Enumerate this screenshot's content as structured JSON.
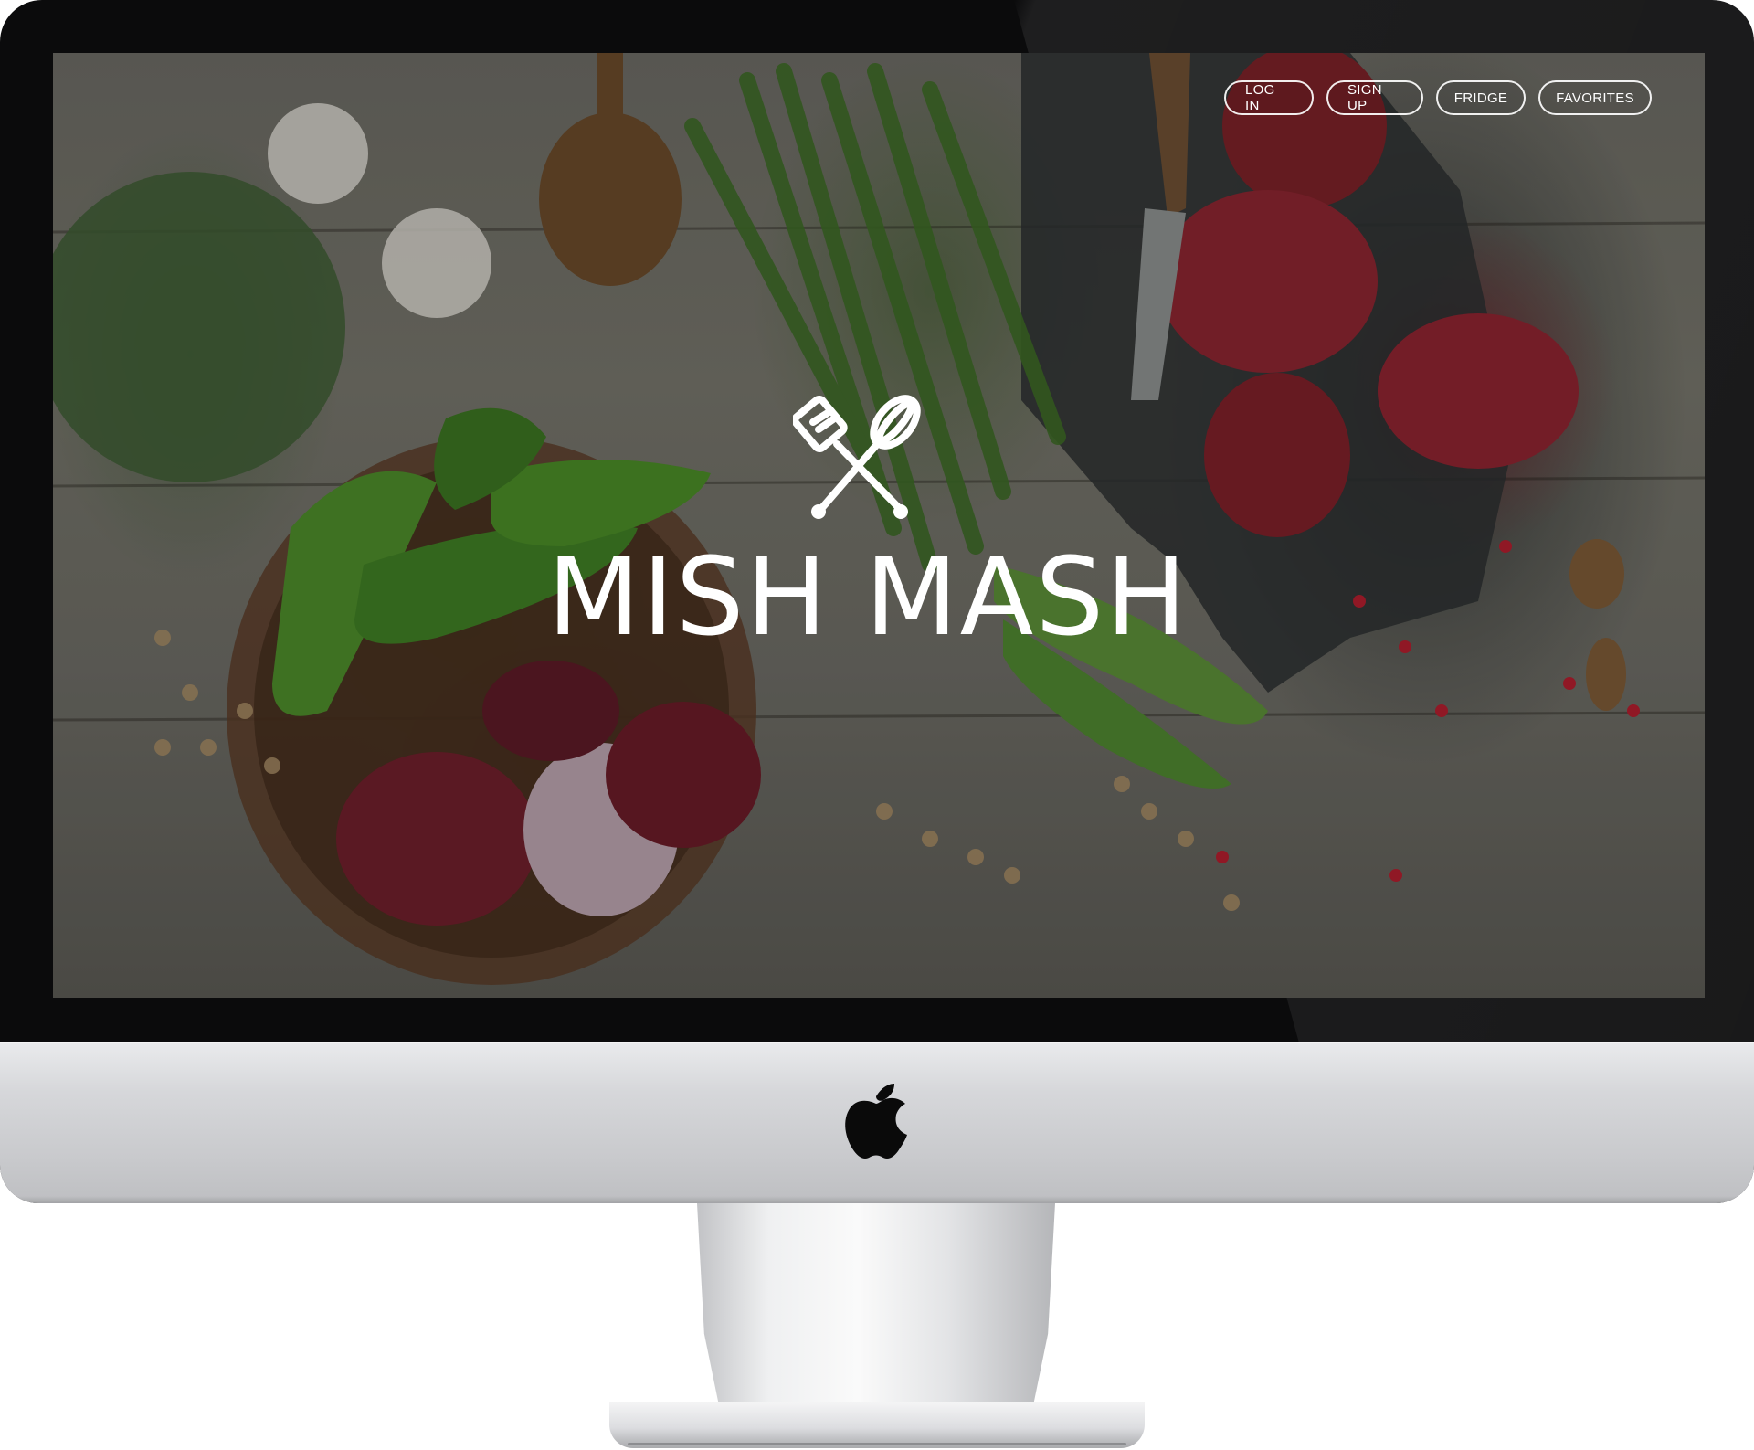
{
  "nav": {
    "login_label": "LOG IN",
    "signup_label": "SIGN UP",
    "fridge_label": "FRIDGE",
    "favorites_label": "FAVORITES"
  },
  "hero": {
    "title": "MISH MASH",
    "logo_icon": "spatula-whisk-crossed-icon"
  },
  "device": {
    "logo_icon": "apple-logo-icon"
  },
  "colors": {
    "text": "#ffffff",
    "bezel": "#0b0b0c",
    "chin": "#d6d7da"
  }
}
